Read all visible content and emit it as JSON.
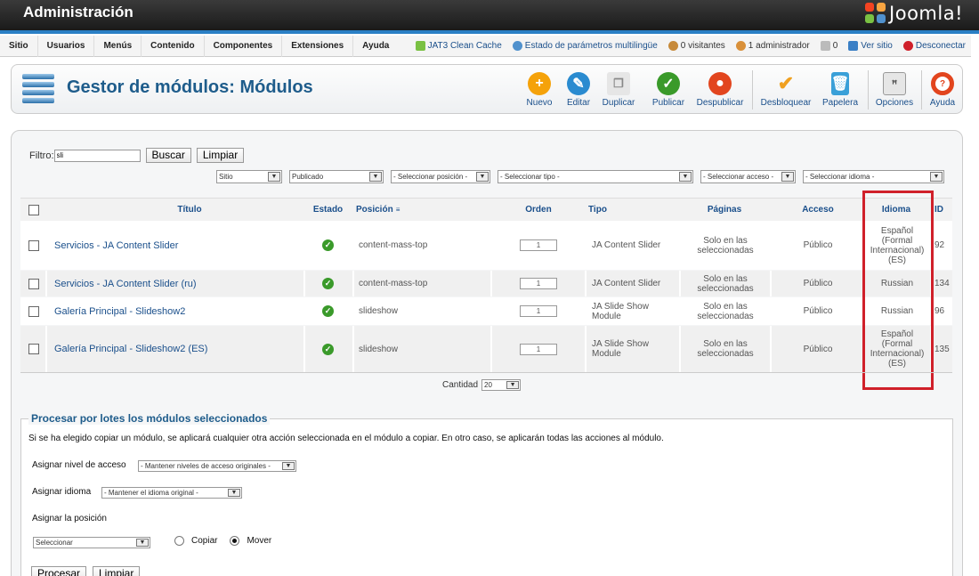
{
  "header": {
    "title": "Administración",
    "logo_text": "Joomla!"
  },
  "menu": {
    "items": [
      "Sitio",
      "Usuarios",
      "Menús",
      "Contenido",
      "Componentes",
      "Extensiones",
      "Ayuda"
    ],
    "status": [
      {
        "icon": "cache-icon",
        "label": "JAT3 Clean Cache",
        "link": true
      },
      {
        "icon": "globe-icon",
        "label": "Estado de parámetros multilingüe",
        "link": true
      },
      {
        "icon": "visitors-icon",
        "label": "0 visitantes",
        "link": false
      },
      {
        "icon": "admin-icon",
        "label": "1 administrador",
        "link": false
      },
      {
        "icon": "messages-icon",
        "label": "0",
        "link": false
      },
      {
        "icon": "monitor-icon",
        "label": "Ver sitio",
        "link": true
      },
      {
        "icon": "logout-icon",
        "label": "Desconectar",
        "link": true
      }
    ]
  },
  "toolbar": {
    "page_title": "Gestor de módulos: Módulos",
    "buttons": [
      {
        "label": "Nuevo",
        "icon": "plus-icon",
        "color": "#f5a20a"
      },
      {
        "label": "Editar",
        "icon": "pencil-icon",
        "color": "#2a8bd0"
      },
      {
        "label": "Duplicar",
        "icon": "copy-icon",
        "color": "#dddddd"
      },
      {
        "label": "Publicar",
        "icon": "publish-icon",
        "color": "#3a9a2a"
      },
      {
        "label": "Despublicar",
        "icon": "unpublish-icon",
        "color": "#e2451e"
      },
      {
        "label": "Desbloquear",
        "icon": "checkin-icon",
        "color": "#f0a020"
      },
      {
        "label": "Papelera",
        "icon": "trash-icon",
        "color": "#3aa0d8"
      },
      {
        "label": "Opciones",
        "icon": "options-icon",
        "color": "#cccccc"
      },
      {
        "label": "Ayuda",
        "icon": "help-icon",
        "color": "#e2451e"
      }
    ]
  },
  "filter": {
    "label": "Filtro:",
    "search_value": "sli",
    "search_button": "Buscar",
    "clear_button": "Limpiar",
    "selects": [
      "Sitio",
      "Publicado",
      "- Seleccionar posición -",
      "- Seleccionar tipo -",
      "- Seleccionar acceso -",
      "- Seleccionar idioma -"
    ]
  },
  "table": {
    "headers": {
      "title": "Título",
      "state": "Estado",
      "position": "Posición",
      "order": "Orden",
      "type": "Tipo",
      "pages": "Páginas",
      "access": "Acceso",
      "language": "Idioma",
      "id": "ID"
    },
    "rows": [
      {
        "title": "Servicios - JA Content Slider",
        "position": "content-mass-top",
        "order": "1",
        "type": "JA Content Slider",
        "pages": "Solo en las seleccionadas",
        "access": "Público",
        "language": "Español (Formal Internacional) (ES)",
        "id": "92"
      },
      {
        "title": "Servicios - JA Content Slider (ru)",
        "position": "content-mass-top",
        "order": "1",
        "type": "JA Content Slider",
        "pages": "Solo en las seleccionadas",
        "access": "Público",
        "language": "Russian",
        "id": "134"
      },
      {
        "title": "Galería Principal - Slideshow2",
        "position": "slideshow",
        "order": "1",
        "type": "JA Slide Show Module",
        "pages": "Solo en las seleccionadas",
        "access": "Público",
        "language": "Russian",
        "id": "96"
      },
      {
        "title": "Galería Principal - Slideshow2 (ES)",
        "position": "slideshow",
        "order": "1",
        "type": "JA Slide Show Module",
        "pages": "Solo en las seleccionadas",
        "access": "Público",
        "language": "Español (Formal Internacional) (ES)",
        "id": "135"
      }
    ],
    "quantity_label": "Cantidad",
    "quantity_value": "20"
  },
  "batch": {
    "legend": "Procesar por lotes los módulos seleccionados",
    "description": "Si se ha elegido copiar un módulo, se aplicará cualquier otra acción seleccionada en el módulo a copiar. En otro caso, se aplicarán todas las acciones al módulo.",
    "access_label": "Asignar nivel de acceso",
    "access_value": "- Mantener niveles de acceso originales -",
    "language_label": "Asignar idioma",
    "language_value": "- Mantener el idioma original -",
    "position_label": "Asignar la posición",
    "position_value": "Seleccionar",
    "copy_label": "Copiar",
    "move_label": "Mover",
    "process_button": "Procesar",
    "clear_button": "Limpiar"
  },
  "colors": {
    "accent": "#1a4f8b",
    "highlight": "#d0202a",
    "published": "#3a9a2a"
  }
}
